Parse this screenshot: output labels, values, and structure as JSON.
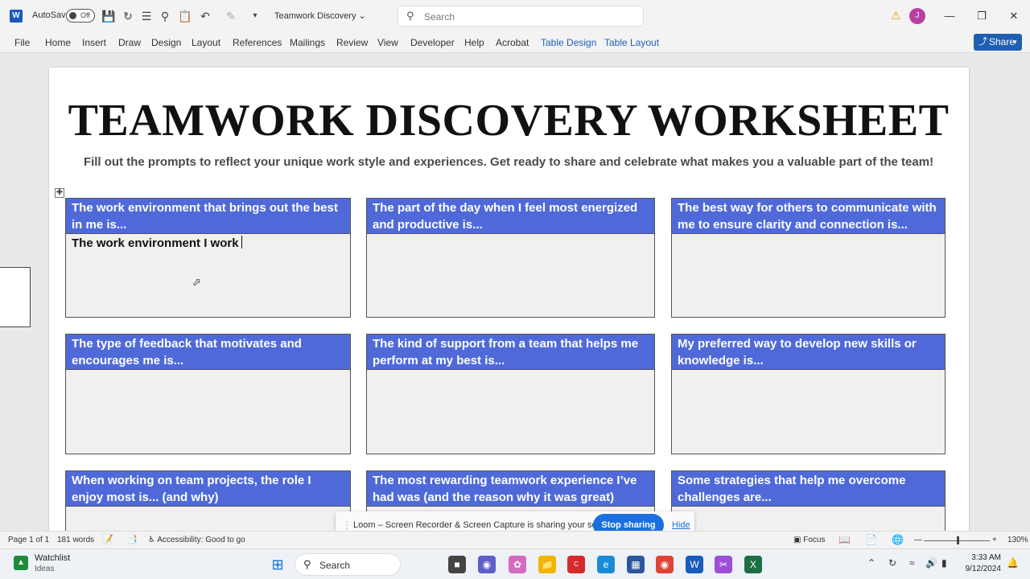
{
  "titlebar": {
    "autosave_label": "AutoSave",
    "autosave_state": "Off",
    "doc_title": "Teamwork Discovery",
    "search_placeholder": "Search",
    "user_initial": "J"
  },
  "ribbon_tabs": [
    "File",
    "Home",
    "Insert",
    "Draw",
    "Design",
    "Layout",
    "References",
    "Mailings",
    "Review",
    "View",
    "Developer",
    "Help",
    "Acrobat",
    "Table Design",
    "Table Layout"
  ],
  "share_label": "Share",
  "document": {
    "heading": "TEAMWORK DISCOVERY WORKSHEET",
    "subheading": "Fill out the prompts to reflect your unique work style and experiences. Get ready to share and celebrate what makes you a valuable part of the team!",
    "cells": [
      {
        "prompt": "The work environment that brings out the best in me is...",
        "response": "The work environment I work"
      },
      {
        "prompt": "The part of the day when I feel most energized and productive is...",
        "response": ""
      },
      {
        "prompt": "The best way for others to communicate with me to ensure clarity and connection is...",
        "response": ""
      },
      {
        "prompt": "The type of feedback that motivates and encourages me is...",
        "response": ""
      },
      {
        "prompt": "The kind of support from a team that helps me perform at my best is...",
        "response": ""
      },
      {
        "prompt": "My preferred way to develop new skills or knowledge is...",
        "response": ""
      },
      {
        "prompt": "When working on team projects, the role I enjoy most is... (and why)",
        "response": ""
      },
      {
        "prompt": "The most rewarding teamwork experience I’ve had was (and the reason why it was great)",
        "response": ""
      },
      {
        "prompt": "Some strategies that help me overcome challenges are...",
        "response": ""
      }
    ]
  },
  "loom": {
    "message": "Loom – Screen Recorder & Screen Capture is sharing your screen.",
    "stop_label": "Stop sharing",
    "hide_label": "Hide"
  },
  "statusbar": {
    "page": "Page 1 of 1",
    "words": "181 words",
    "accessibility": "Accessibility: Good to go",
    "focus": "Focus",
    "zoom": "130%"
  },
  "taskbar": {
    "widget_title": "Watchlist",
    "widget_sub": "Ideas",
    "search_label": "Search",
    "time": "3:33 AM",
    "date": "9/12/2024"
  },
  "colors": {
    "header_fill": "#4f6ad8",
    "word_blue": "#185abd",
    "share_blue": "#1f5fb3",
    "loom_blue": "#1c6fdf"
  }
}
